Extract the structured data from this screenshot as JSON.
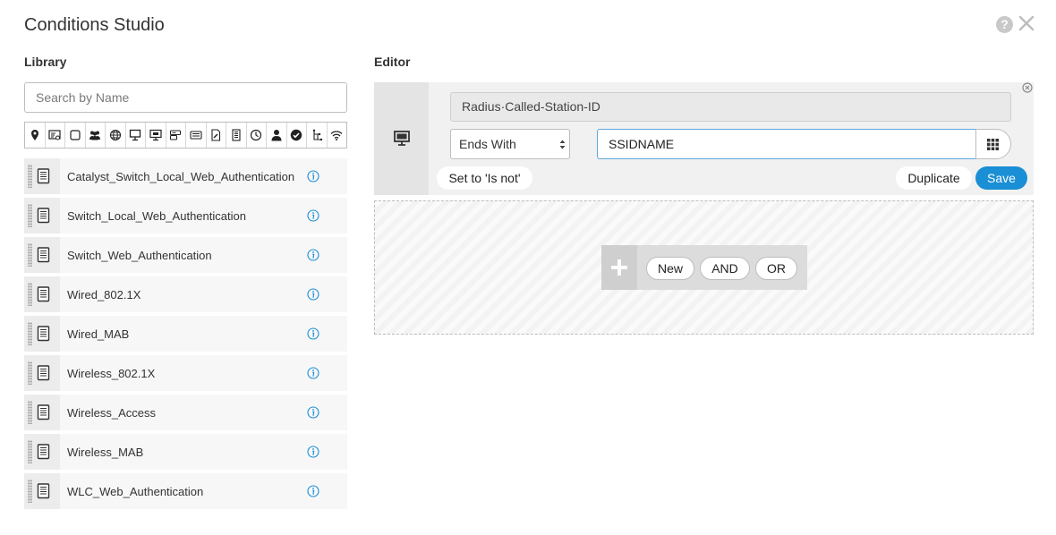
{
  "header": {
    "title": "Conditions Studio",
    "help_glyph": "?"
  },
  "library": {
    "label": "Library",
    "search_placeholder": "Search by Name",
    "filter_icons": [
      "location-pin-icon",
      "id-card-icon",
      "square-icon",
      "users-group-icon",
      "globe-icon",
      "desktop-icon",
      "monitor-icon",
      "router-icon",
      "mail-icon",
      "file-sign-icon",
      "book-icon",
      "clock-icon",
      "person-icon",
      "checkmark-circle-icon",
      "network-tree-icon",
      "wifi-icon"
    ],
    "items": [
      {
        "label": "Catalyst_Switch_Local_Web_Authentication"
      },
      {
        "label": "Switch_Local_Web_Authentication"
      },
      {
        "label": "Switch_Web_Authentication"
      },
      {
        "label": "Wired_802.1X"
      },
      {
        "label": "Wired_MAB"
      },
      {
        "label": "Wireless_802.1X"
      },
      {
        "label": "Wireless_Access"
      },
      {
        "label": "Wireless_MAB"
      },
      {
        "label": "WLC_Web_Authentication"
      }
    ]
  },
  "editor": {
    "label": "Editor",
    "attribute": "Radius·Called-Station-ID",
    "operator": "Ends With",
    "value": "SSIDNAME",
    "set_not_label": "Set to 'Is not'",
    "duplicate_label": "Duplicate",
    "save_label": "Save",
    "accent_color": "#1a8fd6"
  },
  "adder": {
    "new_label": "New",
    "and_label": "AND",
    "or_label": "OR"
  }
}
